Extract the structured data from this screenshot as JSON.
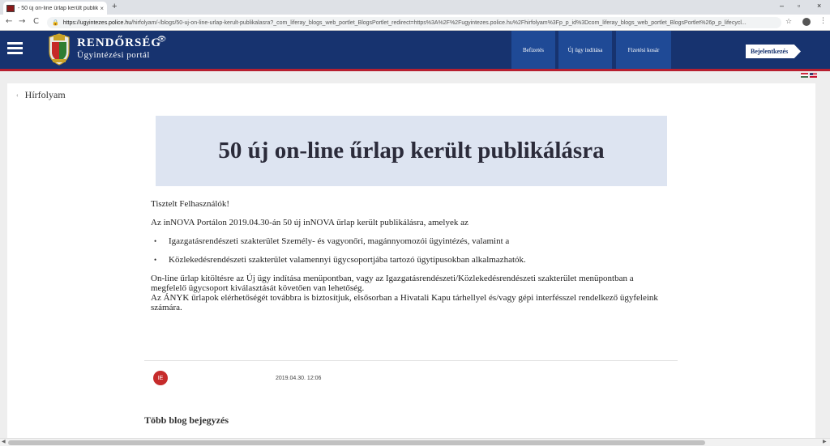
{
  "browser": {
    "tab_title": "- 50 új on-line űrlap került publik",
    "tab_close": "×",
    "new_tab": "+",
    "window_controls": [
      "–",
      "▫",
      "×"
    ],
    "back": "←",
    "forward": "→",
    "reload": "C",
    "url_host": "https://ugyintezes.police.hu",
    "url_path": "/hirfolyam/-/blogs/50-uj-on-line-urlap-kerult-publikalasra?_com_liferay_blogs_web_portlet_BlogsPortlet_redirect=https%3A%2F%2Fugyintezes.police.hu%2Fhirfolyam%3Fp_p_id%3Dcom_liferay_blogs_web_portlet_BlogsPortlet%26p_p_lifecycl...",
    "star": "☆",
    "menu": "⋮"
  },
  "header": {
    "brand_title": "RENDŐRSÉG",
    "brand_subtitle": "Ügyintézési portál",
    "nav": [
      {
        "label": "Befizetés"
      },
      {
        "label": "Új ügy indítása"
      },
      {
        "label": "Fizetési kosár"
      }
    ],
    "login_label": "Bejelentkezés"
  },
  "colors": {
    "header_bg": "#17336f",
    "nav_active_bg": "#1f4a96",
    "accent_red": "#b72030",
    "hero_bg": "#dde4f1"
  },
  "breadcrumb": {
    "chevron": "‹",
    "label": "Hírfolyam"
  },
  "article": {
    "title": "50 új on-line űrlap került publikálásra",
    "greeting": "Tisztelt Felhasználók!",
    "intro": "Az inNOVA Portálon 2019.04.30-án 50 új inNOVA űrlap került publikálásra, amelyek az",
    "bullets": [
      "Igazgatásrendészeti szakterület Személy- és vagyonőri, magánnyomozói ügyintézés, valamint a",
      "Közlekedésrendészeti szakterület valamennyi ügycsoportjába tartozó ügytípusokban alkalmazhatók."
    ],
    "paragraph_lines": [
      "On-line űrlap kitöltésre az Új ügy indítása menüpontban, vagy az Igazgatásrendészeti/Közlekedésrendészeti szakterület menüpontban a",
      "megfelelő ügycsoport kiválasztását követően van lehetőség.",
      "Az ÁNYK űrlapok elérhetőségét továbbra is biztosítjuk, elsősorban a Hivatali Kapu tárhellyel és/vagy gépi interfésszel rendelkező ügyfeleink",
      "számára."
    ]
  },
  "post_meta": {
    "author_initials": "IE",
    "date": "2019.04.30. 12:06"
  },
  "more_posts_title": "Több blog bejegyzés"
}
